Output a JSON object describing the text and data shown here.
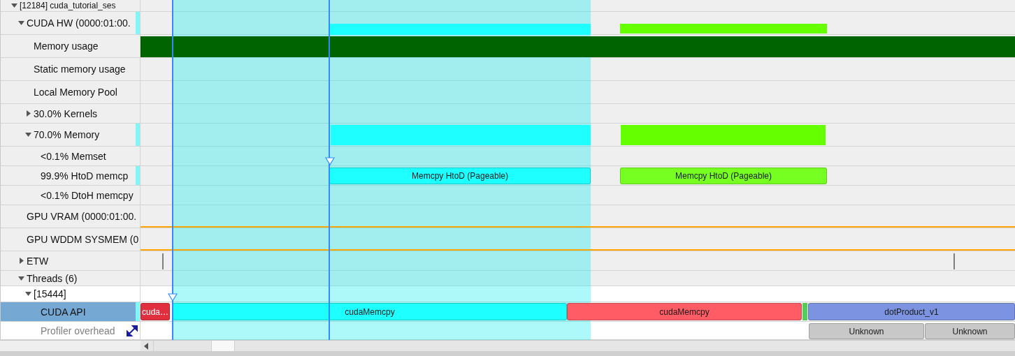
{
  "tracks": [
    {
      "label": "[12184] cuda_tutorial_ses",
      "expanded": true,
      "selected": false,
      "activity": false,
      "dimmed": false,
      "children": [
        {
          "label": "CUDA HW (0000:01:00.",
          "expanded": true,
          "selected": false,
          "activity": true,
          "dimmed": false,
          "bars": [
            {
              "kind": "block",
              "color": "#1effff"
            },
            {
              "kind": "block",
              "color": "#66ff00"
            }
          ],
          "children": [
            {
              "label": "Memory usage",
              "selected": false,
              "activity": false,
              "dimmed": false,
              "bars": [
                {
                  "kind": "block",
                  "color": "#006400"
                }
              ]
            },
            {
              "label": "Static memory usage",
              "selected": false,
              "activity": false,
              "dimmed": false
            },
            {
              "label": "Local Memory Pool",
              "selected": false,
              "activity": false,
              "dimmed": false
            },
            {
              "label": "30.0% Kernels",
              "expanded": false,
              "selected": false,
              "activity": false,
              "dimmed": false
            },
            {
              "label": "70.0% Memory",
              "expanded": true,
              "selected": false,
              "activity": true,
              "dimmed": false,
              "bars": [
                {
                  "kind": "block",
                  "color": "#1effff"
                },
                {
                  "kind": "block",
                  "color": "#66ff00"
                }
              ],
              "children": [
                {
                  "label": "<0.1% Memset",
                  "selected": false,
                  "activity": false,
                  "dimmed": false
                },
                {
                  "label": "99.9% HtoD memcp",
                  "selected": false,
                  "activity": true,
                  "dimmed": false,
                  "bars": [
                    {
                      "kind": "labeled",
                      "color": "#1effff",
                      "label": "Memcpy HtoD (Pageable)"
                    },
                    {
                      "kind": "labeled",
                      "color": "#77ff22",
                      "label": "Memcpy HtoD (Pageable)"
                    }
                  ]
                },
                {
                  "label": "<0.1% DtoH memcpy",
                  "selected": false,
                  "activity": false,
                  "dimmed": false
                }
              ]
            }
          ]
        },
        {
          "label": "GPU VRAM (0000:01:00.",
          "selected": false,
          "activity": false,
          "dimmed": false,
          "bars": [
            {
              "kind": "line",
              "color": "#ffa500"
            }
          ]
        },
        {
          "label": "GPU WDDM SYSMEM (0",
          "selected": false,
          "activity": false,
          "dimmed": false,
          "bars": [
            {
              "kind": "line",
              "color": "#ffa500"
            }
          ]
        },
        {
          "label": "ETW",
          "expanded": false,
          "selected": false,
          "activity": false,
          "dimmed": false,
          "bars": [
            {
              "kind": "tick",
              "color": "#808080"
            },
            {
              "kind": "tick",
              "color": "#808080"
            }
          ]
        },
        {
          "label": "Threads (6)",
          "expanded": true,
          "selected": false,
          "activity": false,
          "dimmed": false,
          "children": [
            {
              "label": "[15444]",
              "expanded": true,
              "selected": false,
              "activity": false,
              "dimmed": false,
              "children": [
                {
                  "label": "CUDA API",
                  "selected": true,
                  "activity": true,
                  "dimmed": false,
                  "bars": [
                    {
                      "kind": "labeled",
                      "color": "#e03040",
                      "label": "cuda…"
                    },
                    {
                      "kind": "labeled",
                      "color": "#1effff",
                      "label": "cudaMemcpy"
                    },
                    {
                      "kind": "labeled",
                      "color": "#ff5c65",
                      "label": "cudaMemcpy"
                    },
                    {
                      "kind": "block",
                      "color": "#55cc55"
                    },
                    {
                      "kind": "labeled",
                      "color": "#7b93e0",
                      "label": "dotProduct_v1"
                    }
                  ]
                },
                {
                  "label": "Profiler overhead",
                  "selected": false,
                  "activity": false,
                  "dimmed": true,
                  "bars": [
                    {
                      "kind": "labeled",
                      "color": "#c8c8c8",
                      "label": "Unknown"
                    },
                    {
                      "kind": "labeled",
                      "color": "#c8c8c8",
                      "label": "Unknown"
                    }
                  ]
                }
              ]
            }
          ]
        }
      ]
    }
  ]
}
